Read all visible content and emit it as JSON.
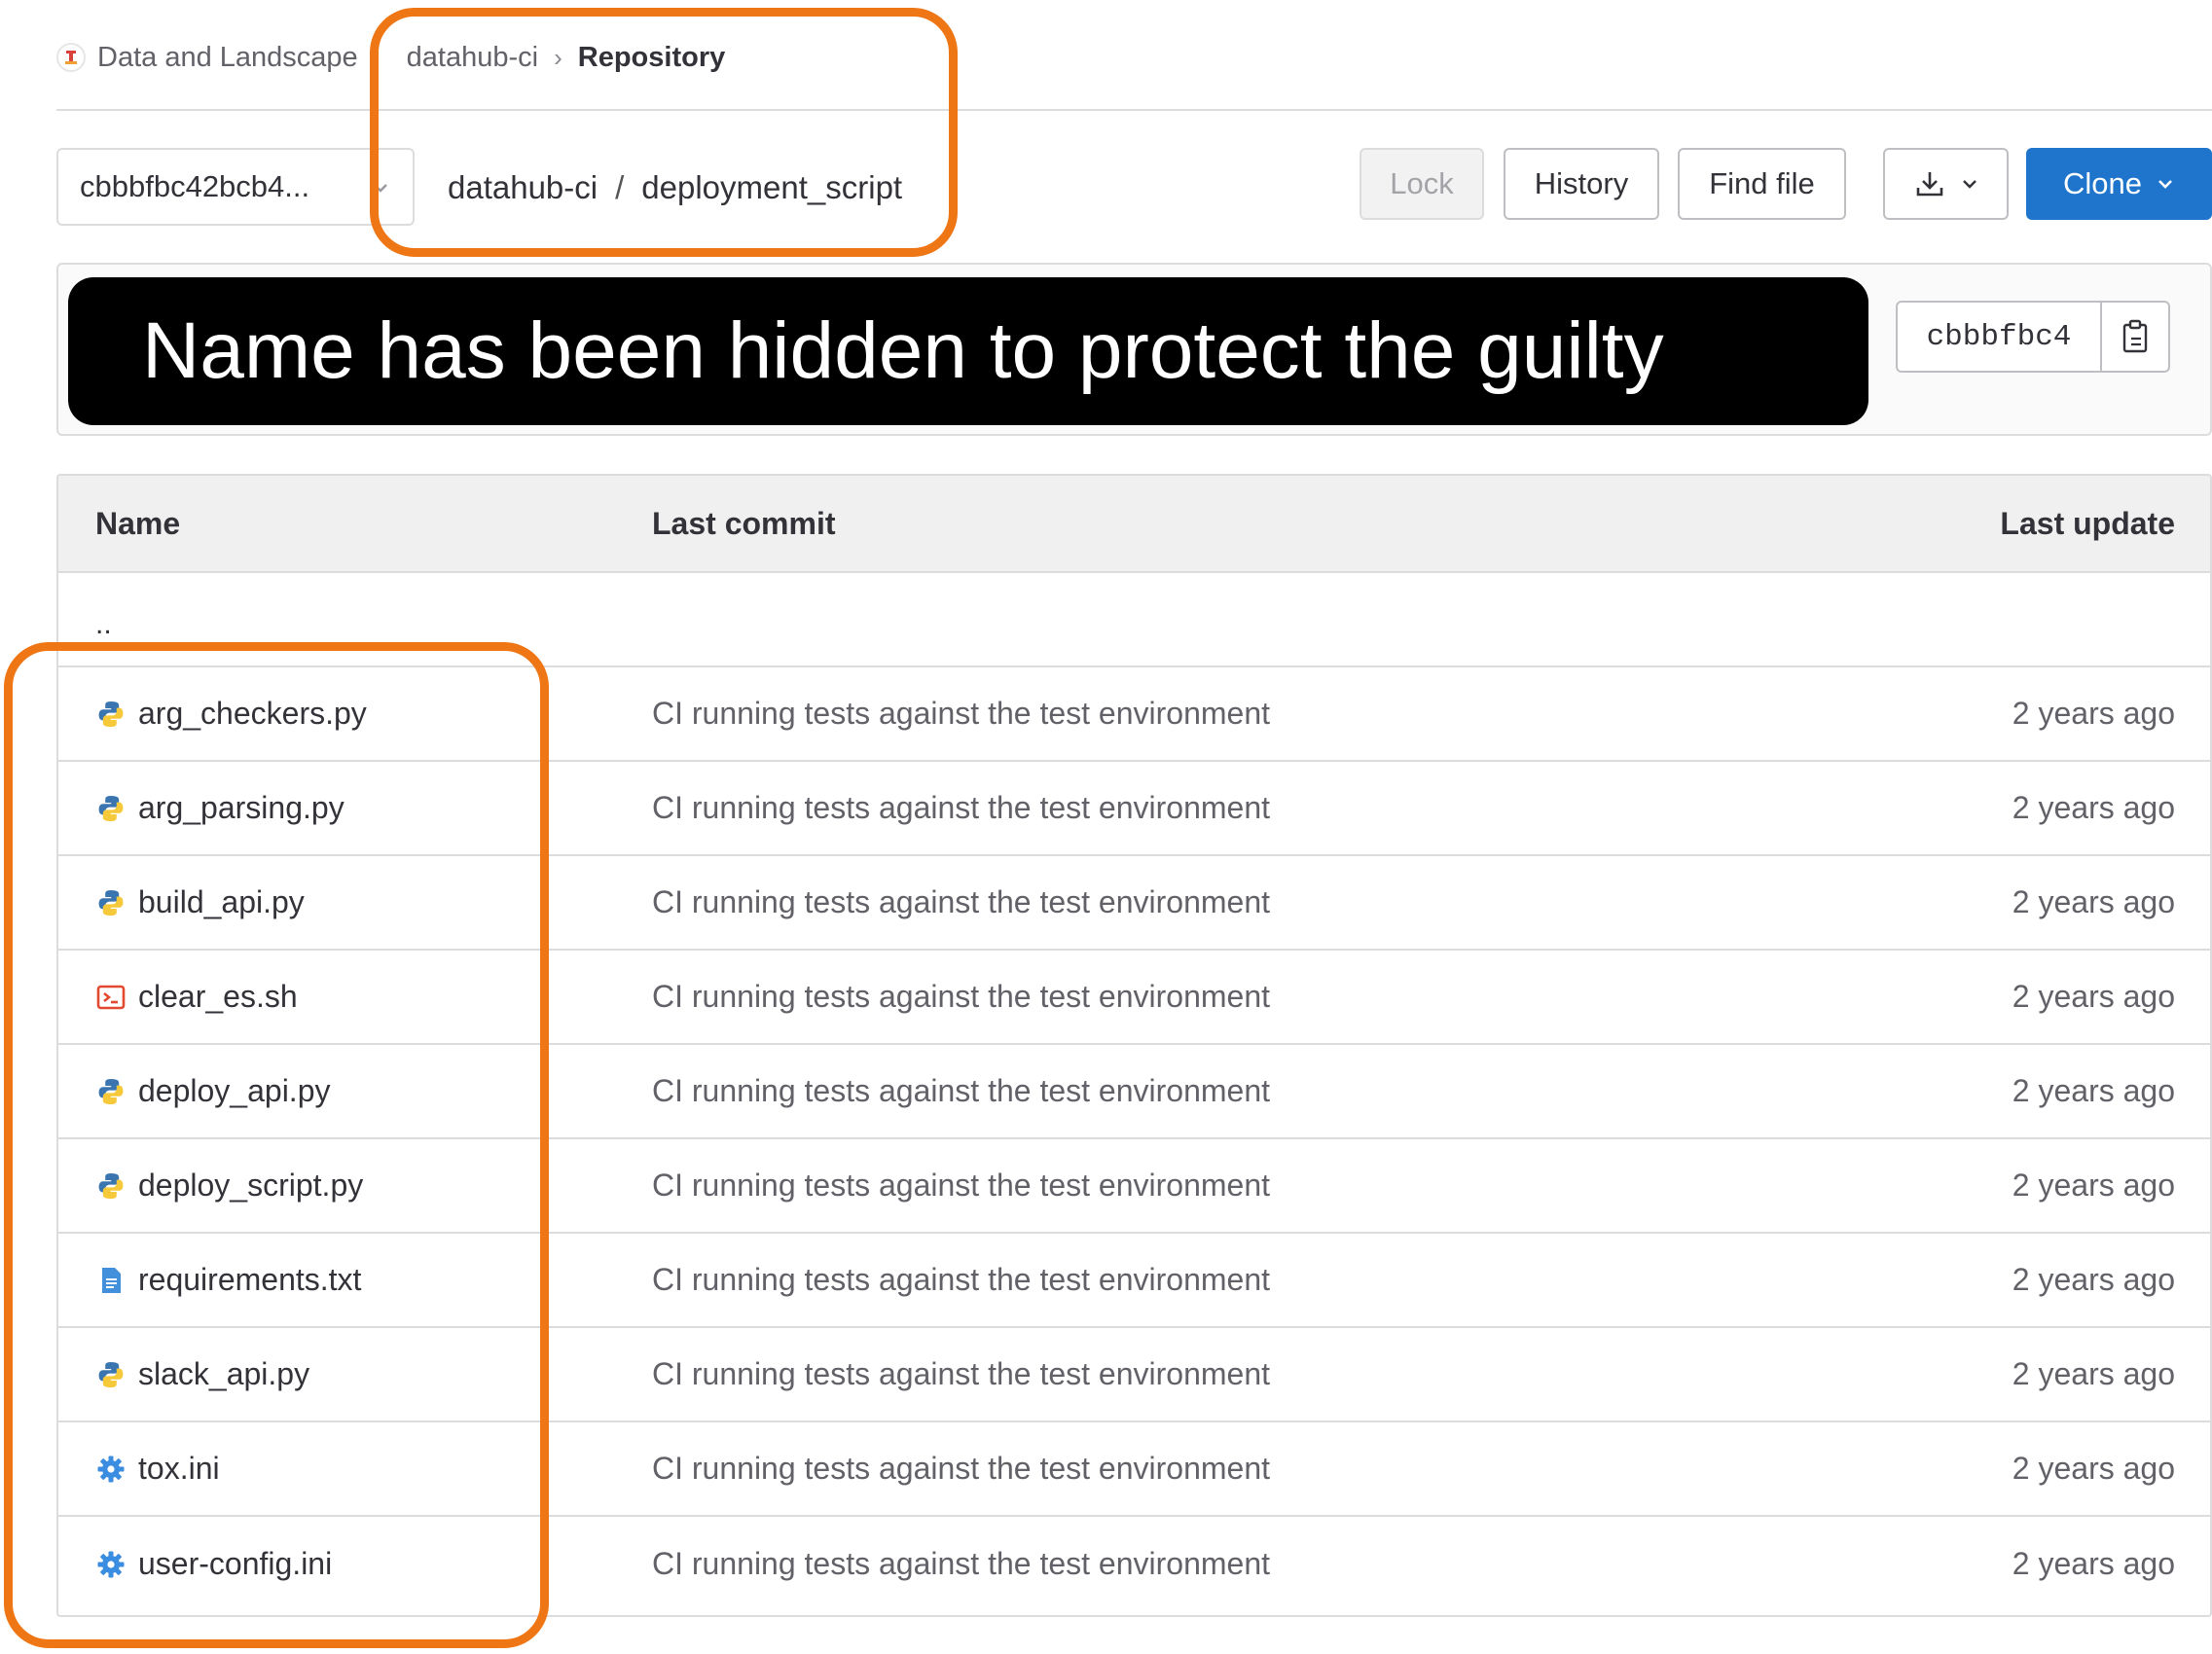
{
  "breadcrumb": {
    "group": "Data and Landscape",
    "project": "datahub-ci",
    "separator": "›",
    "current": "Repository"
  },
  "toolbar": {
    "branch": "cbbbfbc42bcb4...",
    "path_root": "datahub-ci",
    "path_separator": "/",
    "path_dir": "deployment_script",
    "lock_label": "Lock",
    "history_label": "History",
    "find_file_label": "Find file",
    "clone_label": "Clone"
  },
  "commit": {
    "redaction_text": "Name has been hidden to protect the guilty",
    "sha": "cbbbfbc4"
  },
  "table": {
    "headers": {
      "name": "Name",
      "last_commit": "Last commit",
      "last_update": "Last update"
    },
    "parent_dir": "..",
    "files": [
      {
        "name": "arg_checkers.py",
        "icon": "python-icon",
        "commit": "CI running tests against the test environment",
        "updated": "2 years ago"
      },
      {
        "name": "arg_parsing.py",
        "icon": "python-icon",
        "commit": "CI running tests against the test environment",
        "updated": "2 years ago"
      },
      {
        "name": "build_api.py",
        "icon": "python-icon",
        "commit": "CI running tests against the test environment",
        "updated": "2 years ago"
      },
      {
        "name": "clear_es.sh",
        "icon": "terminal-icon",
        "commit": "CI running tests against the test environment",
        "updated": "2 years ago"
      },
      {
        "name": "deploy_api.py",
        "icon": "python-icon",
        "commit": "CI running tests against the test environment",
        "updated": "2 years ago"
      },
      {
        "name": "deploy_script.py",
        "icon": "python-icon",
        "commit": "CI running tests against the test environment",
        "updated": "2 years ago"
      },
      {
        "name": "requirements.txt",
        "icon": "text-file-icon",
        "commit": "CI running tests against the test environment",
        "updated": "2 years ago"
      },
      {
        "name": "slack_api.py",
        "icon": "python-icon",
        "commit": "CI running tests against the test environment",
        "updated": "2 years ago"
      },
      {
        "name": "tox.ini",
        "icon": "gear-icon",
        "commit": "CI running tests against the test environment",
        "updated": "2 years ago"
      },
      {
        "name": "user-config.ini",
        "icon": "gear-icon",
        "commit": "CI running tests against the test environment",
        "updated": "2 years ago"
      }
    ]
  },
  "colors": {
    "annotation": "#ef7615",
    "clone_button": "#1f75cb",
    "python_blue": "#3a75b0",
    "python_yellow": "#f6c93b",
    "shell_red": "#e2492f",
    "text_file_blue": "#428fdc"
  }
}
